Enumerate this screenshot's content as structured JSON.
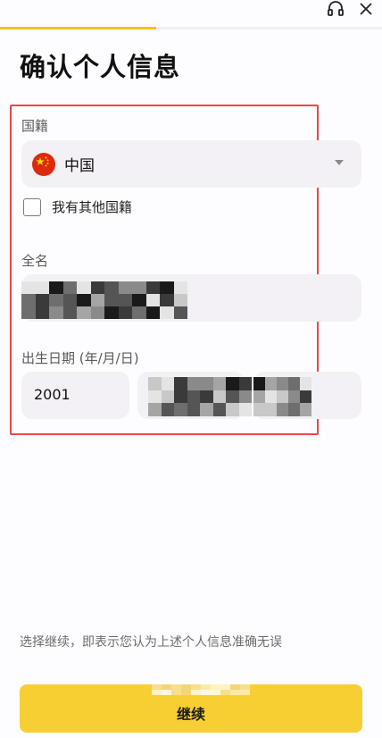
{
  "header": {
    "title": "确认个人信息",
    "progress_fraction": 0.41,
    "support_icon": "headset-icon",
    "close_icon": "close-icon"
  },
  "nationality": {
    "label": "国籍",
    "value": "中国",
    "flag_icon": "china-flag-icon",
    "other_checkbox_label": "我有其他国籍",
    "other_checked": false
  },
  "full_name": {
    "label": "全名",
    "redacted": true
  },
  "birth_date": {
    "label": "出生日期 (年/月/日)",
    "year": "2001",
    "month_redacted": true,
    "day_redacted": true
  },
  "footer": {
    "disclaimer": "选择继续，即表示您认为上述个人信息准确无误",
    "continue_label": "继续"
  },
  "colors": {
    "accent": "#f8cf33",
    "highlight_border": "#e8484c",
    "field_bg": "#f3f1f5"
  }
}
